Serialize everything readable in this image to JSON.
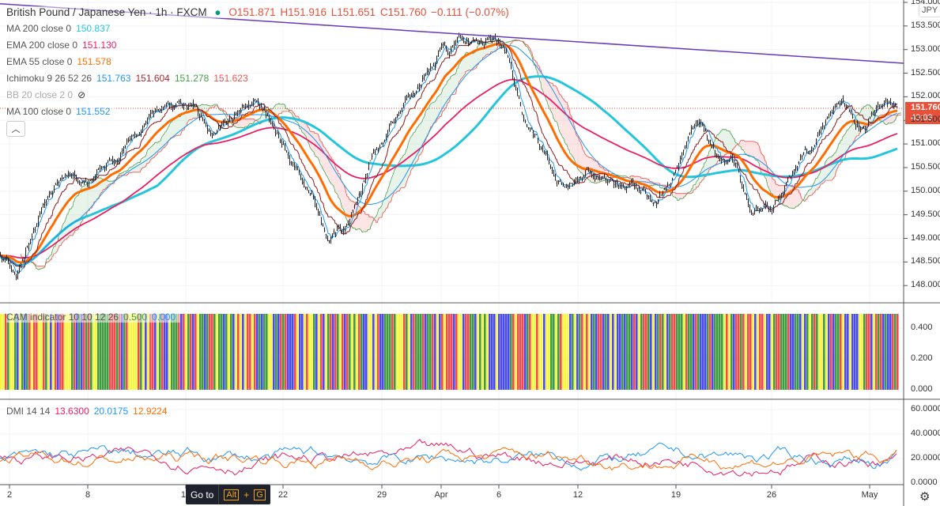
{
  "header": {
    "symbol": "British Pound / Japanese Yen · 1h · FXCM",
    "open": "O151.871",
    "high": "H151.916",
    "low": "L151.651",
    "close": "C151.760",
    "change": "−0.111 (−0.07%)"
  },
  "legend": [
    {
      "name": "MA 200 close 0",
      "value": "150.837",
      "color": "#26c6da"
    },
    {
      "name": "EMA 200 close 0",
      "value": "151.130",
      "color": "#e91e63"
    },
    {
      "name": "EMA 55 close 0",
      "value": "151.578",
      "color": "#ff6d00"
    },
    {
      "name": "Ichimoku 9 26 52 26",
      "values": [
        "151.763",
        "151.604",
        "151.278",
        "151.623"
      ],
      "colors": [
        "#2196f3",
        "#a52a2a",
        "#43a047",
        "#ef5350"
      ]
    },
    {
      "name": "BB 20 close 2 0",
      "hidden": true
    },
    {
      "name": "MA 100 close 0",
      "value": "151.552",
      "color": "#2196f3"
    }
  ],
  "collapse_icon": "chevron-up-icon",
  "currency": "JPY",
  "last_price": "151.760",
  "countdown": "40:03",
  "price_axis": [
    "154.000",
    "153.500",
    "153.000",
    "152.500",
    "152.000",
    "151.500",
    "151.000",
    "150.500",
    "150.000",
    "149.500",
    "149.000",
    "148.500",
    "148.000"
  ],
  "cam": {
    "label": "CAM indicator 10 10 12 26",
    "v1": "0.500",
    "v2": "0.000",
    "axis": [
      "0.400",
      "0.200",
      "0.000"
    ],
    "palette": [
      "#4a4af5",
      "#f24b4b",
      "#3f9b3f",
      "#f5f542"
    ]
  },
  "dmi": {
    "label": "DMI 14 14",
    "v1": "13.6300",
    "v2": "20.0175",
    "v3": "12.9224",
    "axis": [
      "60.0000",
      "40.0000",
      "20.0000",
      "0.0000"
    ]
  },
  "time_axis": [
    "2",
    "8",
    "15",
    "22",
    "29",
    "Apr",
    "6",
    "12",
    "19",
    "26",
    "May"
  ],
  "tooltip": {
    "label": "Go to",
    "key1": "Alt",
    "plus": "+",
    "key2": "G"
  },
  "chart_data": {
    "type": "candlestick",
    "title": "British Pound / Japanese Yen · 1h · FXCM",
    "ylim": [
      147.7,
      154.0
    ],
    "close_keypoints_bar_price": [
      [
        0,
        148.7
      ],
      [
        20,
        148.2
      ],
      [
        50,
        149.5
      ],
      [
        80,
        150.5
      ],
      [
        110,
        150.0
      ],
      [
        150,
        150.8
      ],
      [
        210,
        151.8
      ],
      [
        240,
        151.8
      ],
      [
        270,
        151.3
      ],
      [
        300,
        151.6
      ],
      [
        320,
        151.9
      ],
      [
        350,
        151.2
      ],
      [
        370,
        150.6
      ],
      [
        395,
        149.8
      ],
      [
        415,
        148.8
      ],
      [
        440,
        149.3
      ],
      [
        470,
        150.7
      ],
      [
        490,
        151.3
      ],
      [
        520,
        152.0
      ],
      [
        560,
        152.9
      ],
      [
        590,
        153.1
      ],
      [
        620,
        153.2
      ],
      [
        640,
        153.0
      ],
      [
        660,
        151.5
      ],
      [
        690,
        150.8
      ],
      [
        710,
        150.0
      ],
      [
        740,
        150.5
      ],
      [
        770,
        150.2
      ],
      [
        800,
        150.0
      ],
      [
        830,
        149.8
      ],
      [
        850,
        150.4
      ],
      [
        880,
        151.5
      ],
      [
        910,
        150.7
      ],
      [
        930,
        150.6
      ],
      [
        950,
        149.6
      ],
      [
        975,
        149.7
      ],
      [
        1010,
        150.6
      ],
      [
        1050,
        151.6
      ],
      [
        1065,
        152.0
      ],
      [
        1095,
        151.2
      ],
      [
        1110,
        151.8
      ],
      [
        1135,
        151.76
      ]
    ],
    "trendline": [
      [
        0,
        153.97
      ],
      [
        1143,
        152.71
      ]
    ]
  }
}
